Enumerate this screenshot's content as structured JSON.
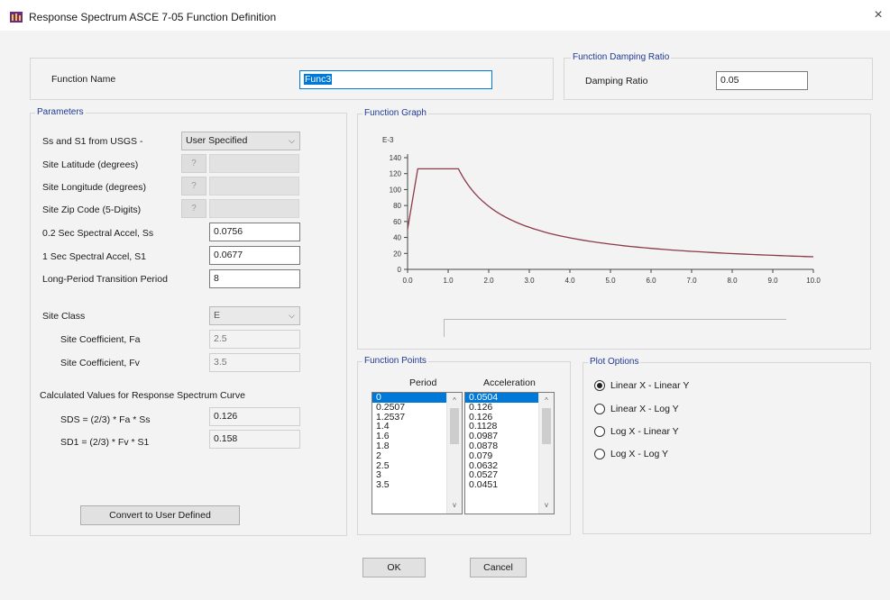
{
  "window": {
    "title": "Response Spectrum ASCE 7-05 Function Definition",
    "close_glyph": "×"
  },
  "function_name": {
    "label": "Function Name",
    "value": "Func3"
  },
  "damping": {
    "group_label": "Function Damping Ratio",
    "label": "Damping Ratio",
    "value": "0.05"
  },
  "parameters": {
    "group_label": "Parameters",
    "ss_s1_label": "Ss and S1 from USGS -",
    "ss_s1_value": "User Specified",
    "latitude_label": "Site Latitude (degrees)",
    "longitude_label": "Site Longitude (degrees)",
    "zip_label": "Site Zip Code (5-Digits)",
    "help_glyph": "?",
    "ss_label": "0.2 Sec Spectral Accel, Ss",
    "ss_value": "0.0756",
    "s1_label": "1 Sec Spectral Accel, S1",
    "s1_value": "0.0677",
    "tl_label": "Long-Period Transition Period",
    "tl_value": "8",
    "site_class_label": "Site Class",
    "site_class_value": "E",
    "fa_label": "Site Coefficient, Fa",
    "fa_value": "2.5",
    "fv_label": "Site Coefficient, Fv",
    "fv_value": "3.5",
    "calc_heading": "Calculated Values for Response Spectrum Curve",
    "sds_label": "SDS = (2/3) * Fa * Ss",
    "sds_value": "0.126",
    "sd1_label": "SD1 = (2/3) * Fv * S1",
    "sd1_value": "0.158",
    "convert_button": "Convert to User Defined"
  },
  "graph": {
    "group_label": "Function Graph",
    "y_multiplier": "E-3"
  },
  "chart_data": {
    "type": "line",
    "title": "",
    "xlabel": "",
    "ylabel": "",
    "xlim": [
      0,
      10
    ],
    "ylim": [
      0,
      140
    ],
    "x_ticks": [
      "0.0",
      "1.0",
      "2.0",
      "3.0",
      "4.0",
      "5.0",
      "6.0",
      "7.0",
      "8.0",
      "9.0",
      "10.0"
    ],
    "y_ticks": [
      "0",
      "20",
      "40",
      "60",
      "80",
      "100",
      "120",
      "140"
    ],
    "y_scale_note": "E-3",
    "grid": false,
    "line_color": "#8b3a4a",
    "series": [
      {
        "x": [
          0,
          0.2507,
          1.2537,
          1.4,
          1.6,
          1.8,
          2,
          2.5,
          3,
          3.5,
          4,
          5,
          6,
          7,
          8,
          9,
          10
        ],
        "y": [
          50.4,
          126,
          126,
          112.8,
          98.7,
          87.8,
          79,
          63.2,
          52.7,
          45.1,
          39.5,
          31.6,
          26.3,
          22.6,
          19.8,
          17.6,
          15.8
        ]
      }
    ]
  },
  "points": {
    "group_label": "Function Points",
    "period_header": "Period",
    "accel_header": "Acceleration",
    "periods": [
      "0",
      "0.2507",
      "1.2537",
      "1.4",
      "1.6",
      "1.8",
      "2",
      "2.5",
      "3",
      "3.5"
    ],
    "accels": [
      "0.0504",
      "0.126",
      "0.126",
      "0.1128",
      "0.0987",
      "0.0878",
      "0.079",
      "0.0632",
      "0.0527",
      "0.0451"
    ],
    "scroll_up": "^",
    "scroll_down": "v"
  },
  "plot_options": {
    "group_label": "Plot Options",
    "options": [
      "Linear X - Linear Y",
      "Linear X - Log Y",
      "Log X - Linear Y",
      "Log X - Log Y"
    ],
    "selected_index": 0
  },
  "buttons": {
    "ok": "OK",
    "cancel": "Cancel"
  },
  "dropdown_glyph": "⌵"
}
